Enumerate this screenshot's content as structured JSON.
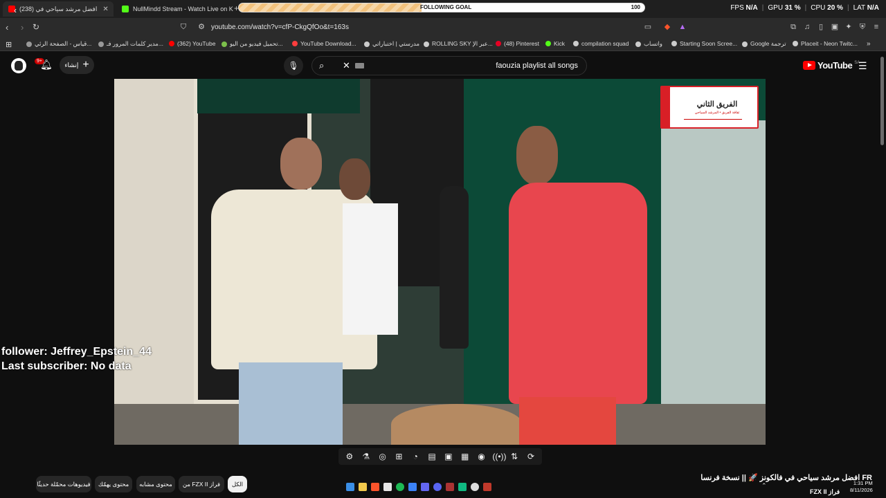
{
  "tabs": [
    {
      "title": "(238) افضل مرشد سياحي في",
      "active": true,
      "color": "#ff0000"
    },
    {
      "title": "NullMindd Stream - Watch Live on K",
      "active": false,
      "color": "#53fc18"
    }
  ],
  "goal": {
    "label": "FOLLOWING GOAL",
    "target": "100",
    "progress_percent": 45
  },
  "stats": [
    {
      "label": "FPS",
      "value": "N/A"
    },
    {
      "label": "GPU",
      "value": "31 %"
    },
    {
      "label": "CPU",
      "value": "20 %"
    },
    {
      "label": "LAT",
      "value": "N/A"
    }
  ],
  "address": {
    "url": "youtube.com/watch?v=cfP-CkgQfOo&t=163s"
  },
  "bookmarks": [
    {
      "label": "قياس - الصفحة الرئي...",
      "color": "#999999"
    },
    {
      "label": "مدير كلمات المرور فـ...",
      "color": "#999999"
    },
    {
      "label": "(362) YouTube",
      "color": "#ff0000"
    },
    {
      "label": "تحميل فيديو من اليو...",
      "color": "#7cc04b"
    },
    {
      "label": "YouTube Download...",
      "color": "#ff3d3d"
    },
    {
      "label": "مدرستي | اختباراتي",
      "color": "#cccccc"
    },
    {
      "label": "ROLLING SKY عبر الإ...",
      "color": "#cccccc"
    },
    {
      "label": "(48) Pinterest",
      "color": "#e60023"
    },
    {
      "label": "Kick",
      "color": "#53fc18"
    },
    {
      "label": "compilation squad",
      "color": "#cccccc"
    },
    {
      "label": "واتساب",
      "color": "#cccccc"
    },
    {
      "label": "Starting Soon Scree...",
      "color": "#cccccc"
    },
    {
      "label": "Google ترجمة",
      "color": "#cccccc"
    },
    {
      "label": "Placeit - Neon Twitc...",
      "color": "#cccccc"
    }
  ],
  "header": {
    "notification_badge": "9+",
    "create_label": "إنشاء",
    "search_query": "faouzia playlist all songs",
    "logo_text": "YouTube",
    "logo_region": "SA"
  },
  "video": {
    "overlay_title": "الفريق الثاني",
    "overlay_subtitle": "ثقافة الفريق • المرشد السياحي",
    "stream_follower_label": "follower: Jeffrey_Epstein_44",
    "stream_subscriber_label": "Last subscriber: No data"
  },
  "chips": [
    {
      "label": "الكل",
      "active": true
    },
    {
      "label": "من FZX II فراز",
      "active": false
    },
    {
      "label": "محتوى مشابه",
      "active": false
    },
    {
      "label": "محتوى يهمّك",
      "active": false
    },
    {
      "label": "فيديوهات محمّلة حديثًا",
      "active": false
    }
  ],
  "up_next_title": "افضل مرشد سياحي في فالكونز 🚀 || نسخة فرنسا FR",
  "tray": {
    "channel": "FZX II فراز",
    "time": "1:31 PM",
    "date": "8/11/2026"
  }
}
